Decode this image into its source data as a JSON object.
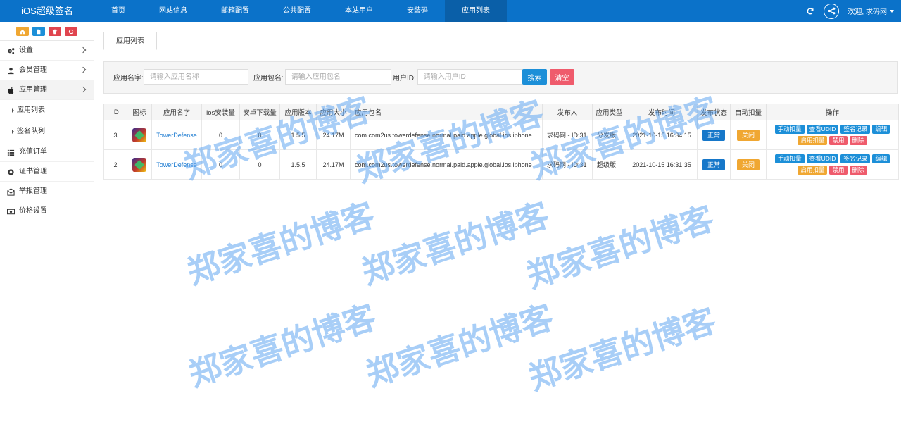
{
  "brand": "iOS超级签名",
  "nav": [
    {
      "label": "首页",
      "active": false
    },
    {
      "label": "网站信息",
      "active": false
    },
    {
      "label": "邮箱配置",
      "active": false
    },
    {
      "label": "公共配置",
      "active": false
    },
    {
      "label": "本站用户",
      "active": false
    },
    {
      "label": "安装码",
      "active": false
    },
    {
      "label": "应用列表",
      "active": true
    }
  ],
  "user": {
    "welcome": "欢迎, 求码网"
  },
  "quick_buttons": [
    {
      "icon": "home-icon",
      "color": "#f0a732"
    },
    {
      "icon": "file-icon",
      "color": "#1c8fd8"
    },
    {
      "icon": "trash-icon",
      "color": "#e0454f"
    },
    {
      "icon": "recycle-icon",
      "color": "#e0454f"
    }
  ],
  "sidebar": {
    "items": [
      {
        "label": "设置",
        "icon": "cogs-icon"
      },
      {
        "label": "会员管理",
        "icon": "user-icon"
      },
      {
        "label": "应用管理",
        "icon": "apple-icon"
      }
    ],
    "sub_items": [
      {
        "label": "应用列表"
      },
      {
        "label": "签名队列"
      }
    ],
    "items_after": [
      {
        "label": "充值订单",
        "icon": "list-icon"
      },
      {
        "label": "证书管理",
        "icon": "cert-icon"
      },
      {
        "label": "举报管理",
        "icon": "envelope-icon"
      },
      {
        "label": "价格设置",
        "icon": "money-icon"
      }
    ]
  },
  "tab": {
    "label": "应用列表"
  },
  "search": {
    "app_name_label": "应用名字:",
    "app_name_placeholder": "请输入应用名称",
    "bundle_label": "应用包名:",
    "bundle_placeholder": "请输入应用包名",
    "user_id_label": "用户ID:",
    "user_id_placeholder": "请输入用户ID",
    "search_btn": "搜索",
    "clear_btn": "清空"
  },
  "table": {
    "headers": [
      "ID",
      "图标",
      "应用名字",
      "ios安装量",
      "安卓下载量",
      "应用版本",
      "应用大小",
      "应用包名",
      "发布人",
      "应用类型",
      "发布时间",
      "发布状态",
      "自动扣量",
      "操作"
    ],
    "rows": [
      {
        "id": "3",
        "name": "TowerDefense",
        "ios": "0",
        "android": "0",
        "version": "1.5.5",
        "size": "24.17M",
        "bundle": "com.com2us.towerdefense.normal.paid.apple.global.ios.iphone",
        "publisher": "求码网 - ID:31",
        "type": "分发版",
        "time": "2021-10-15 16:34:15",
        "status": "正常",
        "auto": "关闭"
      },
      {
        "id": "2",
        "name": "TowerDefense",
        "ios": "0",
        "android": "0",
        "version": "1.5.5",
        "size": "24.17M",
        "bundle": "com.com2us.towerdefense.normal.paid.apple.global.ios.iphone",
        "publisher": "求码网 - ID:31",
        "type": "超级版",
        "time": "2021-10-15 16:31:35",
        "status": "正常",
        "auto": "关闭"
      }
    ],
    "ops_row1": [
      "手动扣量",
      "查看UDID",
      "签名记录",
      "编辑"
    ],
    "ops_row2": [
      "启用扣量",
      "禁用",
      "删除"
    ]
  },
  "watermark": "郑家喜的博客"
}
